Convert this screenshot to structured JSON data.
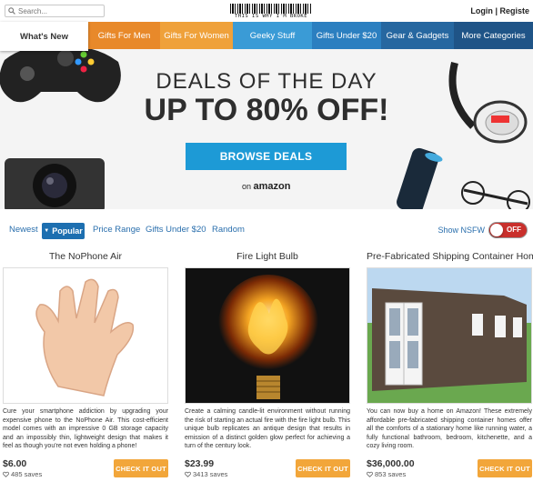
{
  "header": {
    "search_placeholder": "Search...",
    "logo_caption": "THIS IS WHY I'M BROKE",
    "login": "Login",
    "separator": "|",
    "register": "Registe"
  },
  "nav": [
    {
      "label": "What's New"
    },
    {
      "label": "Gifts For Men"
    },
    {
      "label": "Gifts For Women"
    },
    {
      "label": "Geeky Stuff"
    },
    {
      "label": "Gifts Under $20"
    },
    {
      "label": "Gear & Gadgets"
    },
    {
      "label": "More Categories"
    }
  ],
  "hero": {
    "line1": "DEALS OF THE DAY",
    "line2": "UP TO 80% OFF!",
    "button": "BROWSE DEALS",
    "on": "on",
    "amazon": "amazon"
  },
  "filters": {
    "newest": "Newest",
    "popular": "Popular",
    "price_range": "Price Range",
    "gifts_under": "Gifts Under $20",
    "random": "Random",
    "nsfw_label": "Show NSFW",
    "nsfw_state": "OFF"
  },
  "products": [
    {
      "title": "The NoPhone Air",
      "description": "Cure your smartphone addiction by upgrading your expensive phone to the NoPhone Air. This cost-efficient model comes with an impressive 0 GB storage capacity and an impossibly thin, lightweight design that makes it feel as though you're not even holding a phone!",
      "price": "$6.00",
      "saves": "485 saves",
      "button": "CHECK IT OUT"
    },
    {
      "title": "Fire Light Bulb",
      "description": "Create a calming candle-lit environment without running the risk of starting an actual fire with the fire light bulb. This unique bulb replicates an antique design that results in emission of a distinct golden glow perfect for achieving a turn of the century look.",
      "price": "$23.99",
      "saves": "3413 saves",
      "button": "CHECK IT OUT"
    },
    {
      "title": "Pre-Fabricated Shipping Container Home",
      "description": "You can now buy a home on Amazon! These extremely affordable pre-fabricated shipping container homes offer all the comforts of a stationary home like running water, a fully functional bathroom, bedroom, kitchenette, and a cozy living room.",
      "price": "$36,000.00",
      "saves": "853 saves",
      "button": "CHECK IT OUT"
    }
  ],
  "colors": {
    "accent_orange": "#f2a63a",
    "accent_blue": "#1d9ad6",
    "toggle_red": "#c9302c"
  }
}
